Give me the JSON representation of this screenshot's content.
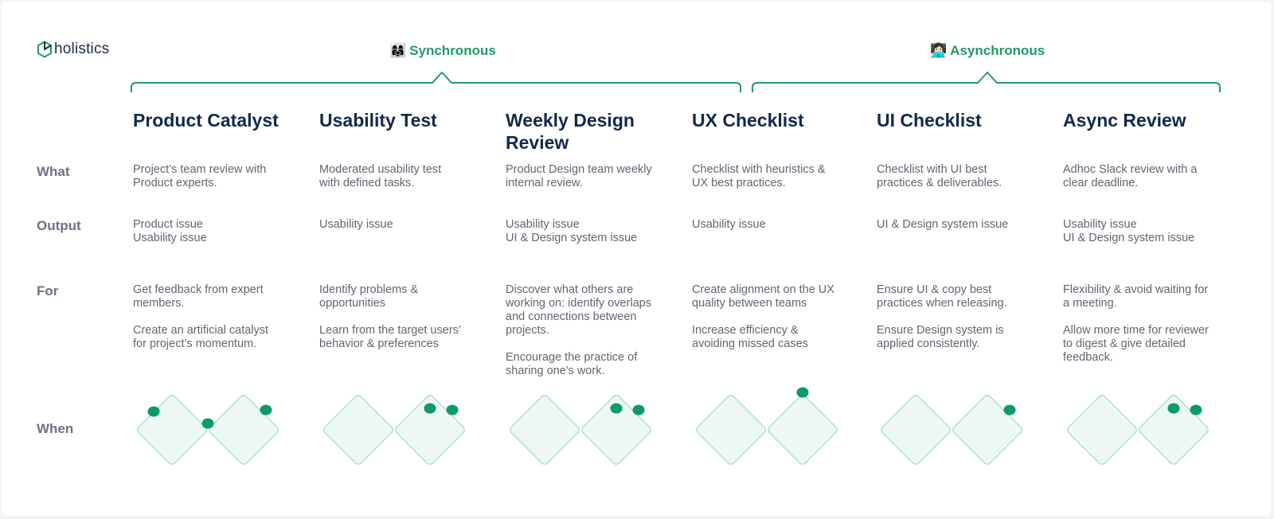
{
  "logo": {
    "text": "holistics"
  },
  "groups": {
    "sync": {
      "emoji": "👩‍👩‍👧",
      "label": "Synchronous"
    },
    "async": {
      "emoji": "👩🏻‍💻",
      "label": "Asynchronous"
    }
  },
  "row_labels": {
    "what": "What",
    "output": "Output",
    "for": "For",
    "when": "When"
  },
  "columns": [
    {
      "title": "Product Catalyst",
      "what": [
        "Project’s team review with",
        "Product experts."
      ],
      "output": [
        "Product issue",
        "Usability issue"
      ],
      "for": [
        [
          "Get feedback from expert",
          "members."
        ],
        [
          "Create an artificial catalyst",
          "for project’s momentum."
        ]
      ],
      "when_dots": [
        "left-top",
        "middle-join",
        "right-right"
      ]
    },
    {
      "title": "Usability Test",
      "what": [
        "Moderated usability test",
        "with defined tasks."
      ],
      "output": [
        "Usability issue"
      ],
      "for": [
        [
          "Identify problems &",
          "opportunities"
        ],
        [
          "Learn from the target users’",
          "behavior & preferences"
        ]
      ],
      "when_dots": [
        "right-top",
        "right-right"
      ]
    },
    {
      "title": "Weekly Design Review",
      "what": [
        "Product Design team weekly",
        "internal review."
      ],
      "output": [
        "Usability issue",
        "UI & Design system issue"
      ],
      "for": [
        [
          "Discover what others are",
          "working on: identify overlaps",
          "and connections between",
          "projects."
        ],
        [
          "Encourage the practice of",
          "sharing one's work."
        ]
      ],
      "when_dots": [
        "right-top",
        "right-right"
      ]
    },
    {
      "title": "UX Checklist",
      "what": [
        "Checklist with heuristics &",
        "UX best practices."
      ],
      "output": [
        "Usability issue"
      ],
      "for": [
        [
          "Create alignment on the UX",
          "quality between teams"
        ],
        [
          "Increase efficiency &",
          "avoiding missed cases"
        ]
      ],
      "when_dots": [
        "right-apex"
      ]
    },
    {
      "title": "UI Checklist",
      "what": [
        "Checklist with UI best",
        "practices & deliverables."
      ],
      "output": [
        "UI & Design system issue"
      ],
      "for": [
        [
          "Ensure UI & copy best",
          "practices when releasing."
        ],
        [
          "Ensure Design system is",
          "applied consistently."
        ]
      ],
      "when_dots": [
        "right-right"
      ]
    },
    {
      "title": "Async Review",
      "what": [
        "Adhoc Slack review with a",
        "clear deadline."
      ],
      "output": [
        "Usability issue",
        "UI & Design system issue"
      ],
      "for": [
        [
          "Flexibility & avoid waiting for",
          "a meeting."
        ],
        [
          "Allow more time for reviewer",
          "to digest & give detailed",
          "feedback."
        ]
      ],
      "when_dots": [
        "right-top",
        "right-right"
      ]
    }
  ],
  "colors": {
    "accent": "#1f9a66",
    "dot": "#0d9a6a",
    "diamond_fill": "#eef8f2",
    "diamond_stroke": "#9fe0c4",
    "title": "#13284a",
    "text": "#5f6670",
    "label": "#6b7280"
  }
}
